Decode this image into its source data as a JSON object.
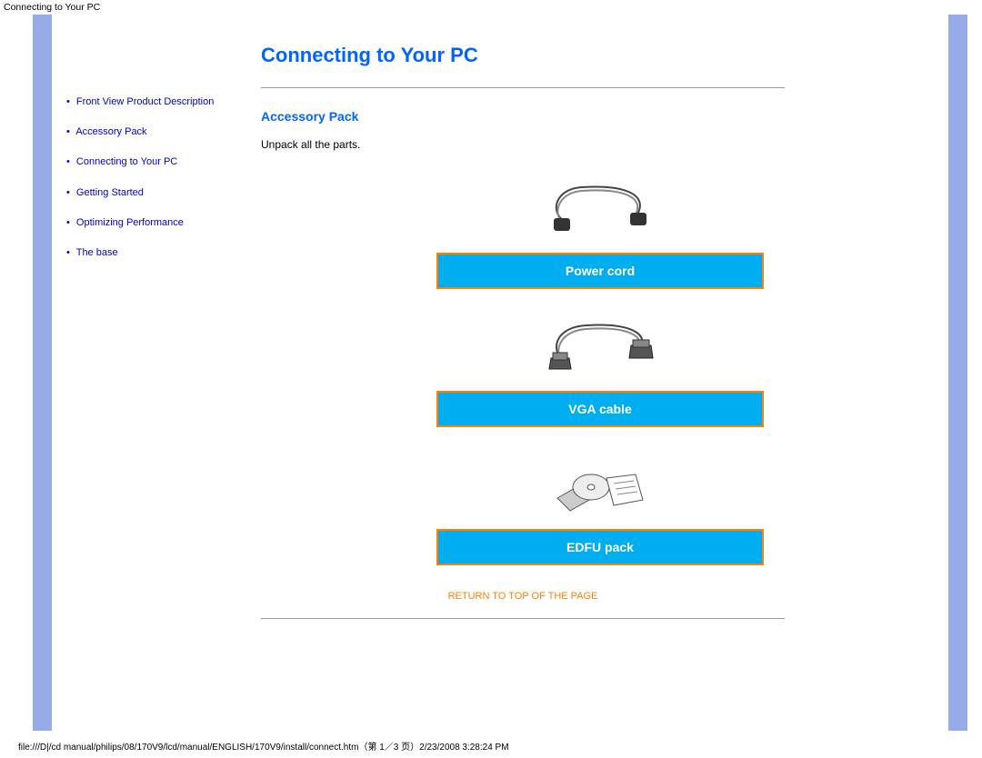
{
  "header": {
    "title": "Connecting to Your PC"
  },
  "sidebar": {
    "items": [
      {
        "label": "Front View Product Description"
      },
      {
        "label": "Accessory Pack"
      },
      {
        "label": "Connecting to Your PC"
      },
      {
        "label": "Getting Started"
      },
      {
        "label": "Optimizing Performance"
      },
      {
        "label": "The base"
      }
    ]
  },
  "main": {
    "title": "Connecting to Your PC",
    "section_title": "Accessory Pack",
    "body_text": "Unpack all the parts.",
    "accessories": [
      {
        "label": "Power cord"
      },
      {
        "label": "VGA cable"
      },
      {
        "label": "EDFU pack"
      }
    ],
    "return_link": "RETURN TO TOP OF THE PAGE"
  },
  "footer": {
    "path": "file:///D|/cd manual/philips/08/170V9/lcd/manual/ENGLISH/170V9/install/connect.htm（第 1／3 页）2/23/2008 3:28:24 PM"
  }
}
